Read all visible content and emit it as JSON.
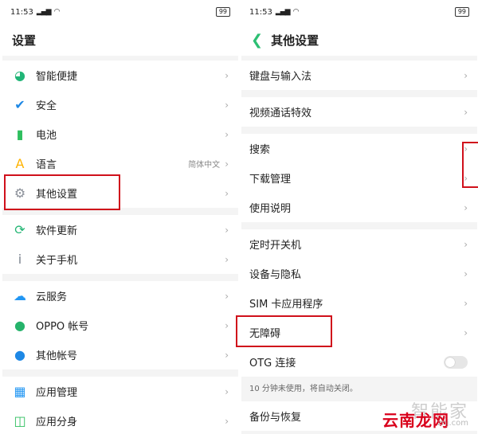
{
  "status": {
    "time": "11:53",
    "battery": "99"
  },
  "left": {
    "title": "设置",
    "groups": [
      [
        {
          "label": "智能便捷",
          "icon": "smart-assist-icon",
          "color": "#21b577"
        },
        {
          "label": "安全",
          "icon": "shield-icon",
          "color": "#1e88e5"
        },
        {
          "label": "电池",
          "icon": "battery-icon",
          "color": "#2fbf5f"
        },
        {
          "label": "语言",
          "icon": "language-icon",
          "color": "#ffb300",
          "value": "简体中文"
        },
        {
          "label": "其他设置",
          "icon": "gear-icon",
          "color": "#8a8f98"
        }
      ],
      [
        {
          "label": "软件更新",
          "icon": "update-icon",
          "color": "#22b573"
        },
        {
          "label": "关于手机",
          "icon": "info-icon",
          "color": "#7d8590"
        }
      ],
      [
        {
          "label": "云服务",
          "icon": "cloud-icon",
          "color": "#2196f3"
        },
        {
          "label": "OPPO 帐号",
          "icon": "user-icon",
          "color": "#26b36b"
        },
        {
          "label": "其他帐号",
          "icon": "user-icon",
          "color": "#1e88e5"
        }
      ],
      [
        {
          "label": "应用管理",
          "icon": "apps-icon",
          "color": "#2196f3"
        },
        {
          "label": "应用分身",
          "icon": "clone-icon",
          "color": "#2fbf5f"
        }
      ]
    ]
  },
  "right": {
    "title": "其他设置",
    "groups": [
      [
        "键盘与输入法"
      ],
      [
        "视频通话特效"
      ],
      [
        "搜索",
        "下载管理",
        "使用说明"
      ],
      [
        "定时开关机",
        "设备与隐私",
        "SIM 卡应用程序",
        "无障碍",
        "OTG 连接"
      ]
    ],
    "note": "10 分钟未使用，将自动关闭。",
    "after_note": "备份与恢复"
  },
  "watermark": {
    "text1": "智能家",
    "text2": "云南龙网",
    "text3": "znj.com"
  }
}
